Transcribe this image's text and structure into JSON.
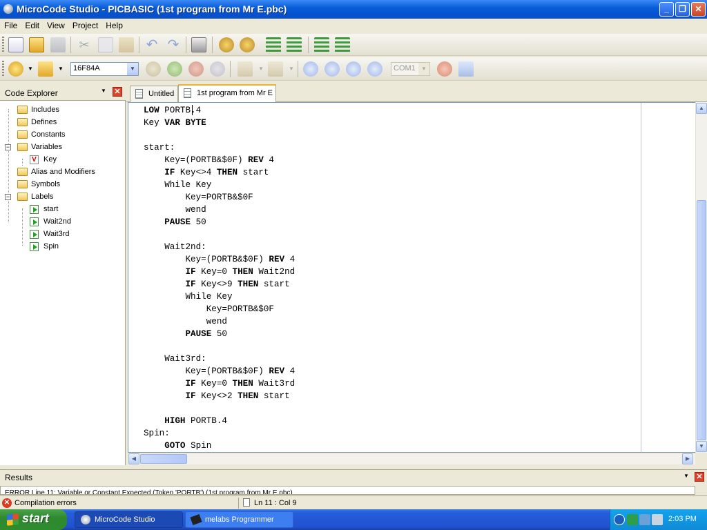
{
  "window": {
    "title": "MicroCode Studio - PICBASIC (1st program from Mr E.pbc)"
  },
  "menu": [
    "File",
    "Edit",
    "View",
    "Project",
    "Help"
  ],
  "toolbar2": {
    "device": "16F84A",
    "port": "COM1"
  },
  "explorer": {
    "title": "Code Explorer",
    "items": [
      "Includes",
      "Defines",
      "Constants",
      "Variables",
      "Key",
      "Alias and Modifiers",
      "Symbols",
      "Labels",
      "start",
      "Wait2nd",
      "Wait3rd",
      "Spin"
    ]
  },
  "tabs": [
    "Untitled",
    "1st program from Mr E"
  ],
  "code": [
    "LOW PORTB.4",
    "Key VAR BYTE",
    "",
    "start:",
    "    Key=(PORTB&$0F) REV 4",
    "    IF Key<>4 THEN start",
    "    While Key",
    "        Key=PORTB&$0F",
    "        wend",
    "    PAUSE 50",
    "",
    "    Wait2nd:",
    "        Key=(PORTB&$0F) REV 4",
    "        IF Key=0 THEN Wait2nd",
    "        IF Key<>9 THEN start",
    "        While Key",
    "            Key=PORTB&$0F",
    "            wend",
    "        PAUSE 50",
    "",
    "    Wait3rd:",
    "        Key=(PORTB&$0F) REV 4",
    "        IF Key=0 THEN Wait3rd",
    "        IF Key<>2 THEN start",
    "",
    "    HIGH PORTB.4",
    "Spin:",
    "    GOTO Spin"
  ],
  "keywords": [
    "LOW",
    "VAR",
    "BYTE",
    "REV",
    "IF",
    "THEN",
    "PAUSE",
    "HIGH",
    "GOTO"
  ],
  "results": {
    "title": "Results",
    "message": "ERROR Line 11: Variable or Constant Expected (Token 'PORTB') (1st program from Mr E.pbc)"
  },
  "status": {
    "errors": "Compilation errors",
    "position": "Ln 11 : Col 9"
  },
  "taskbar": {
    "start": "start",
    "tasks": [
      "MicroCode Studio",
      "melabs Programmer"
    ],
    "clock": "2:03 PM"
  }
}
